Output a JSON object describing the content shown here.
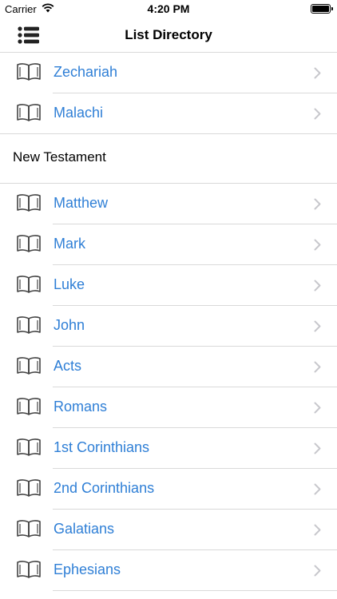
{
  "status": {
    "carrier": "Carrier",
    "time": "4:20 PM"
  },
  "nav": {
    "title": "List Directory",
    "menu_icon": "list-icon"
  },
  "books_top": [
    {
      "label": "Zechariah"
    },
    {
      "label": "Malachi"
    }
  ],
  "section": {
    "label": "New Testament"
  },
  "books": [
    {
      "label": "Matthew"
    },
    {
      "label": "Mark"
    },
    {
      "label": "Luke"
    },
    {
      "label": "John"
    },
    {
      "label": "Acts"
    },
    {
      "label": "Romans"
    },
    {
      "label": "1st Corinthians"
    },
    {
      "label": "2nd Corinthians"
    },
    {
      "label": "Galatians"
    },
    {
      "label": "Ephesians"
    }
  ],
  "colors": {
    "link": "#2f7fd6",
    "separator": "#d9d9d9"
  }
}
